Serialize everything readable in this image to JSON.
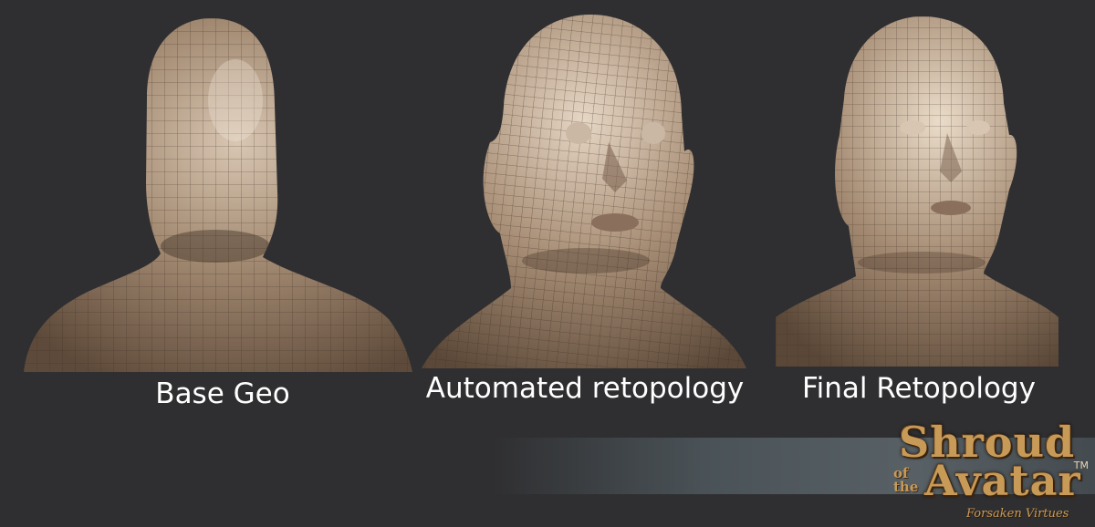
{
  "captions": {
    "base_geo": "Base Geo",
    "automated": "Automated retopology",
    "final": "Final Retopology"
  },
  "logo": {
    "line1": "Shroud",
    "of": "of",
    "the": "the",
    "line2": "Avatar",
    "trademark": "TM",
    "subtitle": "Forsaken Virtues"
  },
  "colors": {
    "background": "#2f2f31",
    "clay": "#a38a72",
    "wire": "#3a2e24",
    "caption": "#ffffff",
    "logo_gold": "#c89a58"
  }
}
